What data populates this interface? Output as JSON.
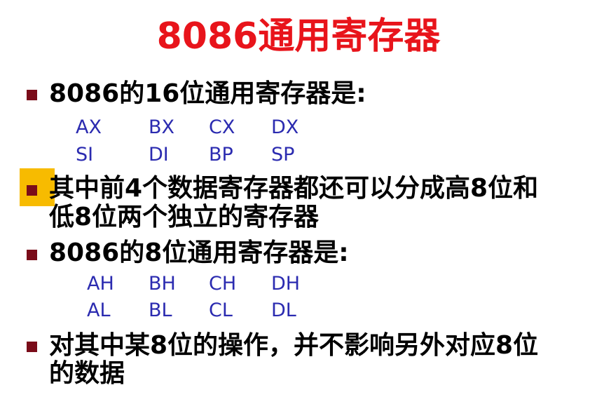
{
  "title": "8086通用寄存器",
  "bullets": [
    {
      "lines": [
        "8086的16位通用寄存器是:"
      ]
    },
    {
      "lines": [
        "其中前4个数据寄存器都还可以分成高8位和",
        "低8位两个独立的寄存器"
      ]
    },
    {
      "lines": [
        "8086的8位通用寄存器是:"
      ]
    },
    {
      "lines": [
        "对其中某8位的操作，并不影响另外对应8位",
        "的数据"
      ]
    }
  ],
  "registers16": [
    [
      "AX",
      "BX",
      "CX",
      "DX"
    ],
    [
      "SI",
      "DI",
      "BP",
      "SP"
    ]
  ],
  "registers8": [
    [
      "AH",
      "BH",
      "CH",
      "DH"
    ],
    [
      "AL",
      "BL",
      "CL",
      "DL"
    ]
  ],
  "colors": {
    "title": "#e8141b",
    "bullet_mark": "#7a0c19",
    "highlight": "#f7bb00",
    "register_text": "#2b2bb0",
    "body_text": "#000000"
  }
}
